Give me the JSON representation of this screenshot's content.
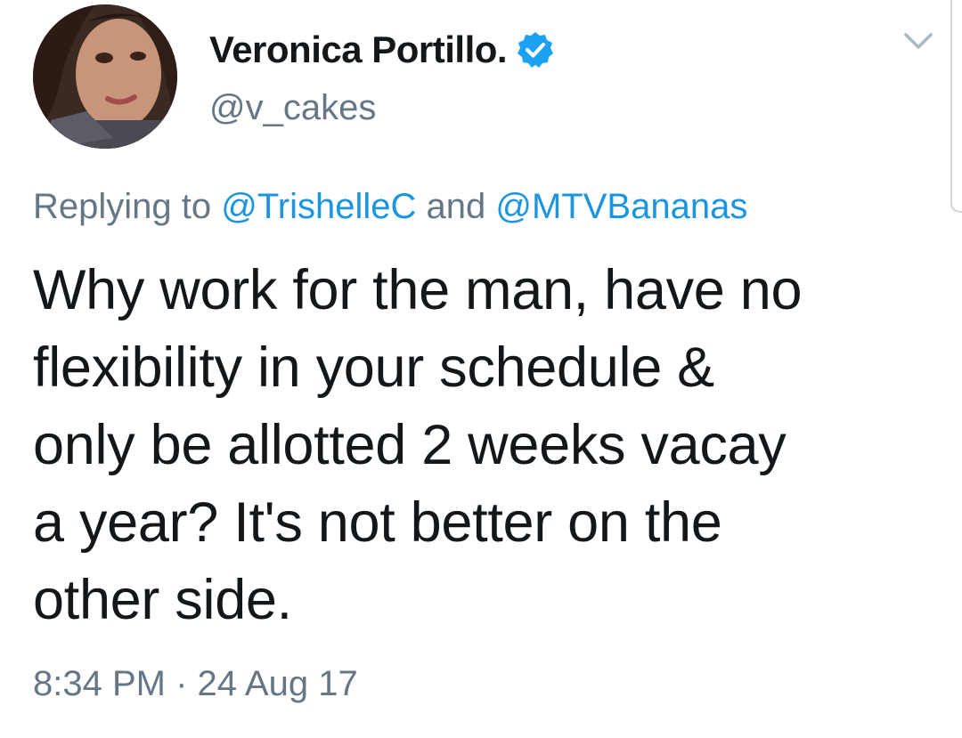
{
  "author": {
    "display_name": "Veronica Portillo.",
    "handle": "@v_cakes",
    "verified": true
  },
  "reply": {
    "prefix": "Replying to ",
    "mention1": "@TrishelleC",
    "joiner": " and ",
    "mention2": "@MTVBananas"
  },
  "tweet": {
    "text": "Why work for the man, have no\nflexibility in your schedule &\nonly be allotted 2 weeks vacay\na year? It's not better on the\nother side."
  },
  "meta": {
    "timestamp": "8:34 PM · 24 Aug 17"
  },
  "icons": {
    "verified": "verified-badge-icon",
    "menu": "chevron-down-icon"
  },
  "colors": {
    "link": "#1b95e0",
    "secondary_text": "#657786",
    "primary_text": "#14171a",
    "verified_badge": "#1da1f2"
  }
}
